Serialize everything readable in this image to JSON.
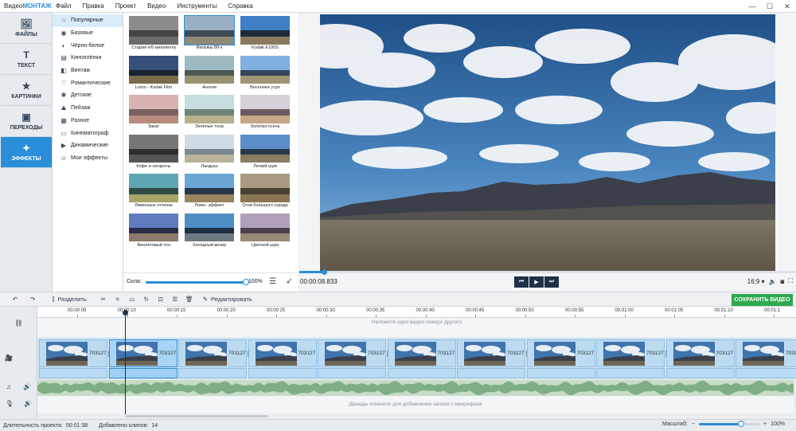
{
  "app": {
    "name_prefix": "Видео",
    "name_brand": "МОНТАЖ",
    "menu": [
      "Файл",
      "Правка",
      "Проект",
      "Видео",
      "Инструменты",
      "Справка"
    ]
  },
  "nav": [
    {
      "label": "ФАЙЛЫ",
      "icon": "image-icon",
      "glyph": "🖼"
    },
    {
      "label": "ТЕКСТ",
      "icon": "text-icon",
      "glyph": "T"
    },
    {
      "label": "КАРТИНКИ",
      "icon": "star-icon",
      "glyph": "★"
    },
    {
      "label": "ПЕРЕХОДЫ",
      "icon": "transitions-icon",
      "glyph": "▣"
    },
    {
      "label": "ЭФФЕКТЫ",
      "icon": "magic-wand-icon",
      "glyph": "✦"
    }
  ],
  "active_nav": "ЭФФЕКТЫ",
  "categories": [
    {
      "label": "Популярные",
      "glyph": "☆"
    },
    {
      "label": "Базовые",
      "glyph": "◉"
    },
    {
      "label": "Чёрно-белое",
      "glyph": "◐"
    },
    {
      "label": "Киноплёнки",
      "glyph": "▤"
    },
    {
      "label": "Винтаж",
      "glyph": "◧"
    },
    {
      "label": "Романтические",
      "glyph": "♡"
    },
    {
      "label": "Детские",
      "glyph": "✱"
    },
    {
      "label": "Пейзаж",
      "glyph": "⛰"
    },
    {
      "label": "Разное",
      "glyph": "▦"
    },
    {
      "label": "Кинематограф",
      "glyph": "▭"
    },
    {
      "label": "Динамические",
      "glyph": "▶"
    },
    {
      "label": "Мои эффекты",
      "glyph": "☺"
    }
  ],
  "active_category": "Популярные",
  "effects": [
    {
      "label": "Старая ч/б кинолента",
      "sky": "#8c8c8c",
      "mnt": "#444",
      "grd": "#6b6b6b"
    },
    {
      "label": "Фильмы 80-х",
      "sky": "#9ab0c4",
      "mnt": "#3f4a54",
      "grd": "#8f8a78"
    },
    {
      "label": "Kodak E100S",
      "sky": "#3f7fc6",
      "mnt": "#1e2c3a",
      "grd": "#8a7a5c"
    },
    {
      "label": "Lomo - Kodak Film",
      "sky": "#35507a",
      "mnt": "#1a2230",
      "grd": "#7a6a4a"
    },
    {
      "label": "Ангели",
      "sky": "#9cbac0",
      "mnt": "#4c5a54",
      "grd": "#9a9370"
    },
    {
      "label": "Весеннее утро",
      "sky": "#7fb0e0",
      "mnt": "#34465a",
      "grd": "#a09575"
    },
    {
      "label": "Закат",
      "sky": "#d8b2b0",
      "mnt": "#7a6060",
      "grd": "#b88b7c"
    },
    {
      "label": "Зеленые тона",
      "sky": "#c8dde0",
      "mnt": "#6f8477",
      "grd": "#b7b08d"
    },
    {
      "label": "Золотая осень",
      "sky": "#d8d0d8",
      "mnt": "#6a5a60",
      "grd": "#c7a783"
    },
    {
      "label": "Кофе и сигареты",
      "sky": "#777",
      "mnt": "#2e2e2e",
      "grd": "#555"
    },
    {
      "label": "Ландыш",
      "sky": "#cfdce4",
      "mnt": "#7d8790",
      "grd": "#b8b29a"
    },
    {
      "label": "Легкий шум",
      "sky": "#5b8ec8",
      "mnt": "#29394a",
      "grd": "#8a7c60"
    },
    {
      "label": "Лимонные оттенки",
      "sky": "#5ea6b2",
      "mnt": "#2e4a44",
      "grd": "#a8a468"
    },
    {
      "label": "Ломо- эффект",
      "sky": "#6aa5d6",
      "mnt": "#26384a",
      "grd": "#988560"
    },
    {
      "label": "Огни большого города",
      "sky": "#a89a80",
      "mnt": "#4a4030",
      "grd": "#8a7652"
    },
    {
      "label": "Фиолетовый тон",
      "sky": "#5f7cbf",
      "mnt": "#2a2e4a",
      "grd": "#8a7a6a"
    },
    {
      "label": "Холодный вечер",
      "sky": "#4f8ec7",
      "mnt": "#1d2f40",
      "grd": "#6d7a80"
    },
    {
      "label": "Цветной шум",
      "sky": "#b0a0b8",
      "mnt": "#4a4050",
      "grd": "#9a8a78"
    }
  ],
  "selected_effect": "Фильмы 80-х",
  "strength": {
    "label": "Сила:",
    "value_text": "100%",
    "value": 1.0
  },
  "player": {
    "time": "00:00:08.833",
    "progress": 0.05,
    "aspect": "16:9",
    "controls": [
      "⏮",
      "▶",
      "⏭"
    ]
  },
  "toolbar": {
    "split": "Разделить",
    "edit": "Редактировать",
    "save": "СОХРАНИТЬ ВИДЕО"
  },
  "ruler": [
    "00:00:05",
    "00:00:10",
    "00:00:15",
    "00:00:20",
    "00:00:25",
    "00:00:30",
    "00:00:35",
    "00:00:40",
    "00:00:45",
    "00:00:50",
    "00:00:55",
    "00:01:00",
    "00:01:05",
    "00:01:10",
    "00:01:1"
  ],
  "timeline": {
    "overlay_hint": "Наложите одно видео поверх другого",
    "mic_hint": "Дважды кликните для добавления записи с микрофона",
    "clip_label": "703127",
    "clip_count": 11,
    "selected_clip": 1
  },
  "status": {
    "duration_label": "Длительность проекта:",
    "duration": "00:01:38",
    "clips_label": "Добавлено клипов:",
    "clips": "14",
    "zoom_label": "Масштаб:",
    "zoom_value": "100%",
    "zoom_level": 0.7
  }
}
